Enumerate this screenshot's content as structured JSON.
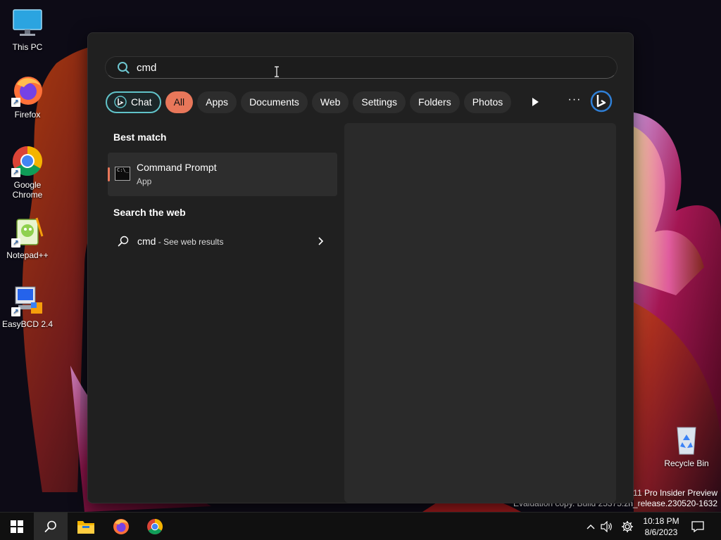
{
  "desktop": {
    "icons": [
      {
        "label": "This PC"
      },
      {
        "label": "Firefox"
      },
      {
        "label": "Google Chrome"
      },
      {
        "label": "Notepad++"
      },
      {
        "label": "EasyBCD 2.4"
      },
      {
        "label": "Recycle Bin"
      }
    ],
    "watermark": {
      "line1": "s 11 Pro Insider Preview",
      "line2": "Evaluation copy. Build 25375.zn_release.230520-1632"
    }
  },
  "search": {
    "query": "cmd",
    "filters": [
      {
        "label": "Chat"
      },
      {
        "label": "All",
        "active": true
      },
      {
        "label": "Apps"
      },
      {
        "label": "Documents"
      },
      {
        "label": "Web"
      },
      {
        "label": "Settings"
      },
      {
        "label": "Folders"
      },
      {
        "label": "Photos"
      }
    ],
    "more_label": "···",
    "best_match": {
      "title": "Best match",
      "item_name": "Command Prompt",
      "item_type": "App",
      "icon_text": "C:\\_"
    },
    "web": {
      "title": "Search the web",
      "query": "cmd",
      "suffix": " - See web results"
    }
  },
  "taskbar": {
    "time": "10:18 PM",
    "date": "8/6/2023"
  },
  "colors": {
    "accent": "#e8775a",
    "chat_border": "#61c3c9",
    "panel_bg": "#202020"
  }
}
